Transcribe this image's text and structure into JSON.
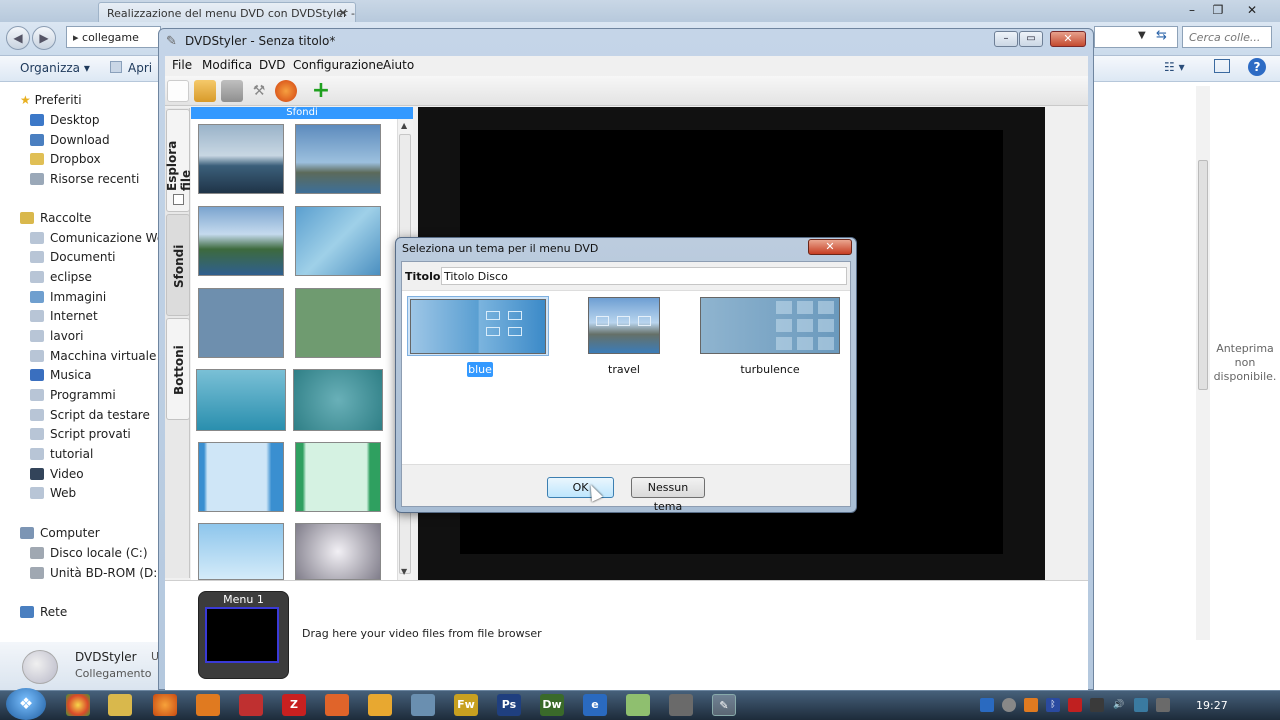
{
  "explorer": {
    "tab_title": "Realizzazione del menu DVD con DVDStyler - Mozilla",
    "address": "collegame",
    "search_placeholder": "Cerca colle...",
    "toolbar": {
      "organize": "Organizza",
      "open": "Apri"
    },
    "nav": {
      "favorites_head": "Preferiti",
      "favorites": [
        "Desktop",
        "Download",
        "Dropbox",
        "Risorse recenti"
      ],
      "libraries_head": "Raccolte",
      "libraries": [
        "Comunicazione Wel",
        "Documenti",
        "eclipse",
        "Immagini",
        "Internet",
        "lavori",
        "Macchina virtuale",
        "Musica",
        "Programmi",
        "Script da testare",
        "Script provati",
        "tutorial",
        "Video",
        "Web"
      ],
      "computer_head": "Computer",
      "computer": [
        "Disco locale (C:)",
        "Unità BD-ROM (D:)"
      ],
      "network_head": "Rete"
    },
    "preview_text": "Anteprima non disponibile.",
    "status": {
      "name": "DVDStyler",
      "type": "Collegamento",
      "extra": "U"
    }
  },
  "dvdstyler": {
    "title": "DVDStyler - Senza titolo*",
    "menu": [
      "File",
      "Modifica",
      "DVD",
      "Configurazione",
      "Aiuto"
    ],
    "side_tabs": {
      "file_browser": "Esplora file",
      "backgrounds": "Sfondi",
      "buttons": "Bottoni"
    },
    "backgrounds_header": "Sfondi",
    "menu1_label": "Menu 1",
    "drag_hint": "Drag here your video files from file browser"
  },
  "dialog": {
    "title": "Seleziona un tema per il menu DVD",
    "title_label": "Titolo:",
    "title_value": "Titolo Disco",
    "themes": [
      {
        "name": "blue",
        "selected": true
      },
      {
        "name": "travel",
        "selected": false
      },
      {
        "name": "turbulence",
        "selected": false
      }
    ],
    "ok_label": "OK",
    "no_theme_label": "Nessun tema"
  },
  "taskbar": {
    "clock": "19:27"
  }
}
